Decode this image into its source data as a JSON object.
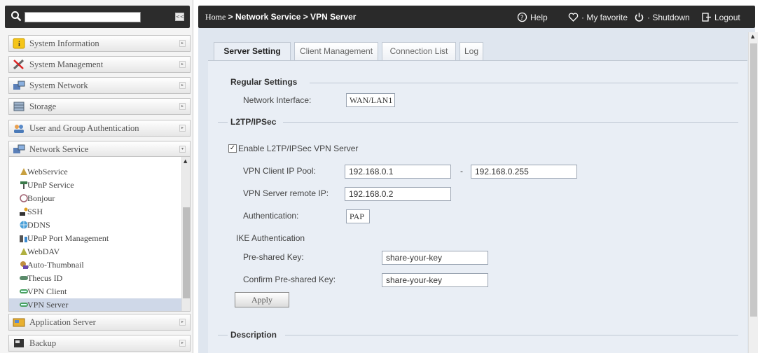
{
  "sidebar": {
    "search": {
      "value": ""
    },
    "collapse_label": "<<",
    "categories": [
      {
        "label": "System Information",
        "icon": "info-icon"
      },
      {
        "label": "System Management",
        "icon": "tools-icon"
      },
      {
        "label": "System Network",
        "icon": "network-icon"
      },
      {
        "label": "Storage",
        "icon": "storage-icon"
      },
      {
        "label": "User and Group Authentication",
        "icon": "users-icon"
      },
      {
        "label": "Network Service",
        "icon": "network-service-icon"
      },
      {
        "label": "Application Server",
        "icon": "app-server-icon"
      },
      {
        "label": "Backup",
        "icon": "backup-icon"
      }
    ],
    "network_service_items": [
      {
        "label": "WebService",
        "icon": "webservice-icon"
      },
      {
        "label": "UPnP Service",
        "icon": "upnp-icon"
      },
      {
        "label": "Bonjour",
        "icon": "bonjour-icon"
      },
      {
        "label": "SSH",
        "icon": "ssh-icon"
      },
      {
        "label": "DDNS",
        "icon": "ddns-icon"
      },
      {
        "label": "UPnP Port Management",
        "icon": "port-icon"
      },
      {
        "label": "WebDAV",
        "icon": "webdav-icon"
      },
      {
        "label": "Auto-Thumbnail",
        "icon": "thumbnail-icon"
      },
      {
        "label": "Thecus ID",
        "icon": "id-icon"
      },
      {
        "label": "VPN Client",
        "icon": "vpn-client-icon"
      },
      {
        "label": "VPN Server",
        "icon": "vpn-server-icon",
        "active": true
      }
    ]
  },
  "header": {
    "breadcrumb_home": "Home",
    "breadcrumb_rest": " > Network Service > VPN Server",
    "help": "Help",
    "favorite": "My favorite",
    "shutdown": "Shutdown",
    "logout": "Logout"
  },
  "tabs": [
    "Server Setting",
    "Client Management",
    "Connection List",
    "Log"
  ],
  "regular": {
    "title": "Regular Settings",
    "network_interface_label": "Network Interface:",
    "network_interface_value": "WAN/LAN1"
  },
  "l2tp": {
    "title": "L2TP/IPSec",
    "enable_label": "Enable L2TP/IPSec VPN Server",
    "enabled": true,
    "check_mark": "✓",
    "client_pool_label": "VPN Client IP Pool:",
    "pool_start": "192.168.0.1",
    "pool_sep": "-",
    "pool_end": "192.168.0.255",
    "remote_ip_label": "VPN Server remote IP:",
    "remote_ip": "192.168.0.2",
    "auth_label": "Authentication:",
    "auth_value": "PAP",
    "ike_label": "IKE Authentication",
    "psk_label": "Pre-shared Key:",
    "psk_value": "share-your-key",
    "confirm_psk_label": "Confirm Pre-shared Key:",
    "confirm_psk_value": "share-your-key",
    "apply": "Apply"
  },
  "description": {
    "title": "Description"
  }
}
